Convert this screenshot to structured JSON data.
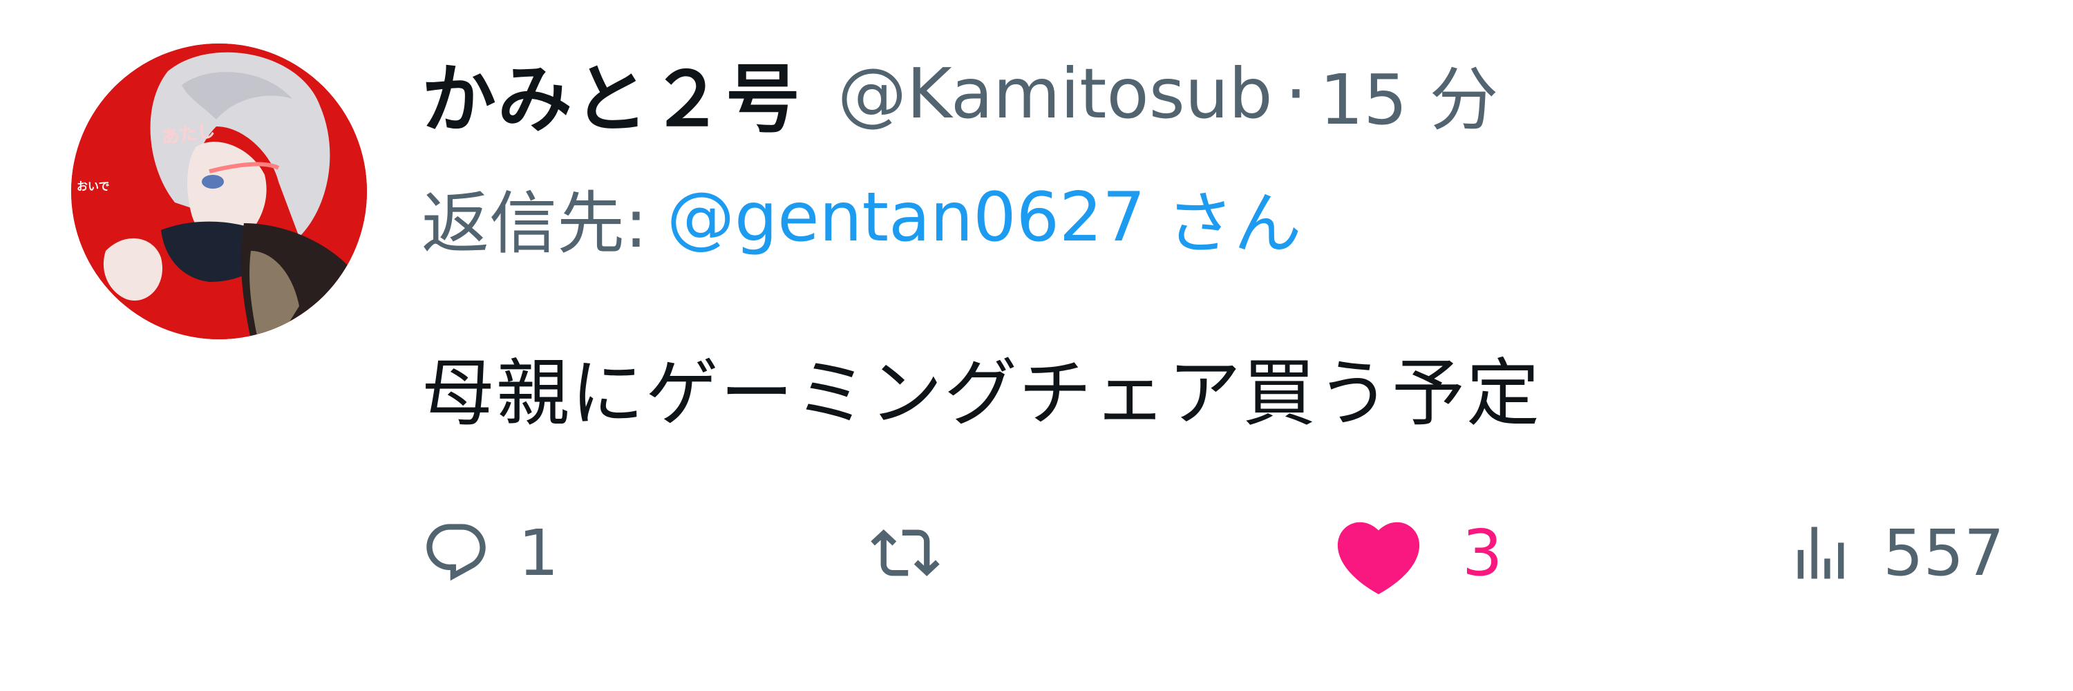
{
  "tweet": {
    "display_name": "かみと２号",
    "handle": "@Kamitosub",
    "separator": "·",
    "time": "15 分",
    "reply_prefix": "返信先:",
    "reply_user": "@gentan0627",
    "reply_suffix": "さん",
    "body": "母親にゲーミングチェア買う予定"
  },
  "avatar": {
    "caption_small": "おいで",
    "caption_main": "あたし"
  },
  "actions": {
    "reply_count": "1",
    "retweet_count": "",
    "like_count": "3",
    "views_count": "557"
  },
  "icons": {
    "reply": "reply-bubble-icon",
    "retweet": "retweet-icon",
    "like": "heart-icon",
    "views": "views-chart-icon"
  },
  "colors": {
    "primary_text": "#0f1419",
    "secondary_text": "#536471",
    "link": "#1d9bf0",
    "like_active": "#f91880",
    "avatar_bg": "#d81414"
  }
}
